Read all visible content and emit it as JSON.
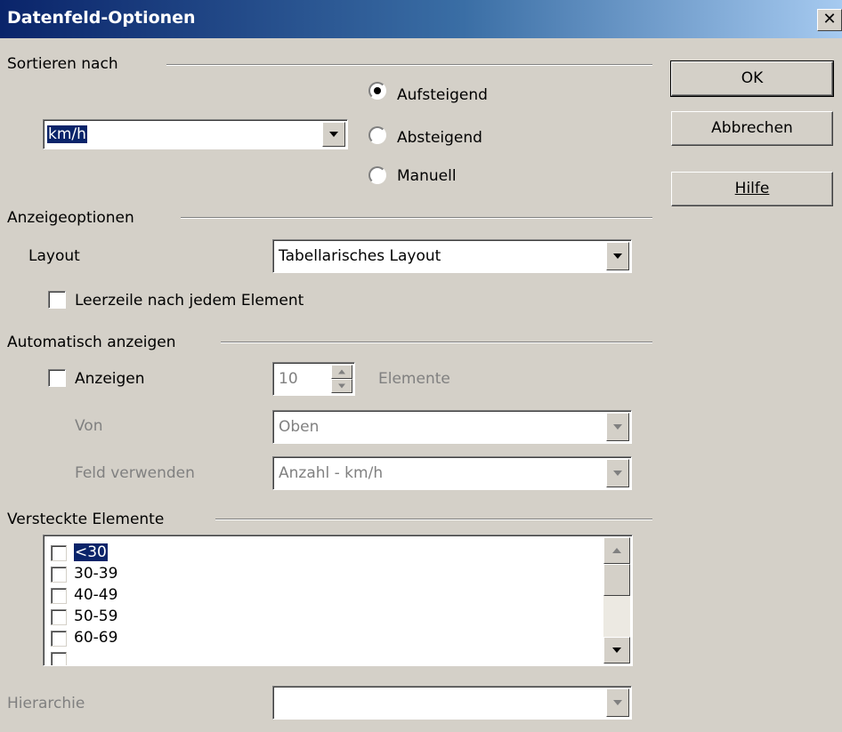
{
  "dialog": {
    "title": "Datenfeld-Optionen",
    "close_symbol": "✕"
  },
  "buttons": {
    "ok": "OK",
    "cancel": "Abbrechen",
    "help": "Hilfe"
  },
  "sort": {
    "section_label": "Sortieren nach",
    "field_value": "km/h",
    "options": [
      {
        "label": "Aufsteigend",
        "selected": true
      },
      {
        "label": "Absteigend",
        "selected": false
      },
      {
        "label": "Manuell",
        "selected": false
      }
    ]
  },
  "display": {
    "section_label": "Anzeigeoptionen",
    "layout_label": "Layout",
    "layout_value": "Tabellarisches Layout",
    "empty_line_label": "Leerzeile nach jedem Element",
    "empty_line_checked": false
  },
  "autoshow": {
    "section_label": "Automatisch anzeigen",
    "show_label": "Anzeigen",
    "show_checked": false,
    "count_value": "10",
    "count_unit": "Elemente",
    "from_label": "Von",
    "from_value": "Oben",
    "use_field_label": "Feld verwenden",
    "use_field_value": "Anzahl - km/h"
  },
  "hidden_items": {
    "section_label": "Versteckte Elemente",
    "items": [
      "<30",
      "30-39",
      "40-49",
      "50-59",
      "60-69"
    ]
  },
  "hierarchy": {
    "label": "Hierarchie",
    "value": ""
  },
  "colors": {
    "title_start": "#0a246a",
    "title_end": "#a6caf0",
    "face": "#d4d0c8",
    "selection": "#0a246a"
  }
}
